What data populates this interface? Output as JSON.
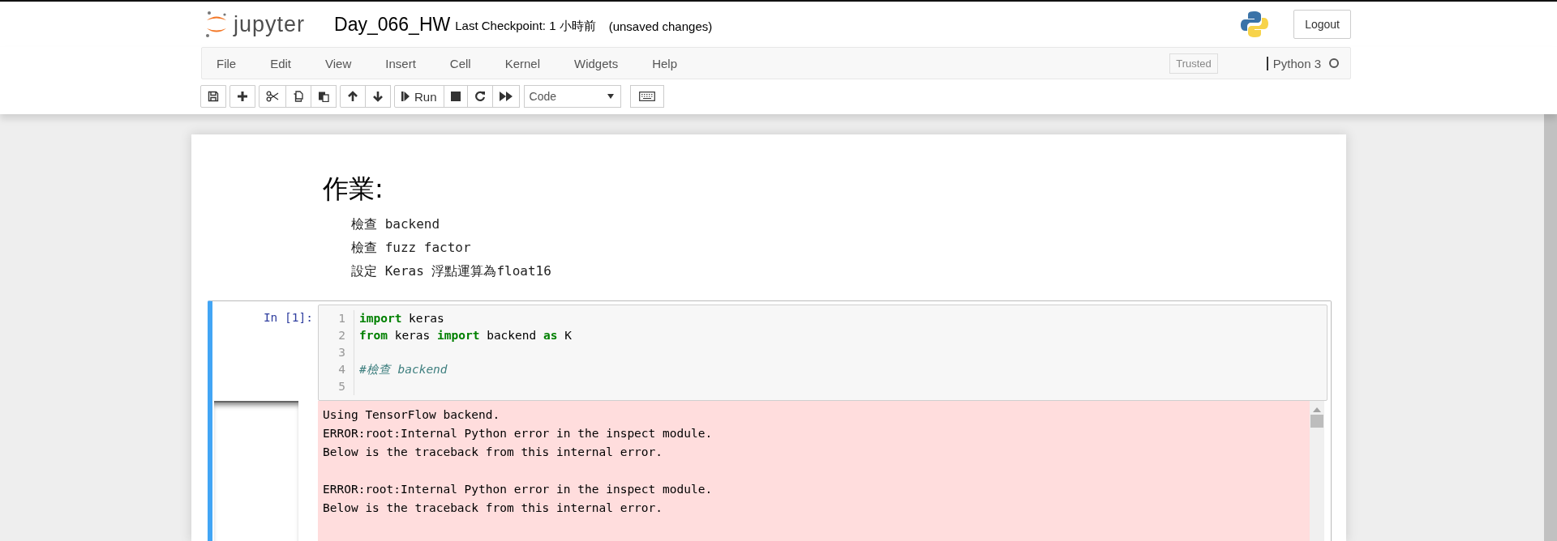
{
  "header": {
    "logo_text": "jupyter",
    "notebook_name": "Day_066_HW",
    "checkpoint": "Last Checkpoint: 1 小時前",
    "autosave": "(unsaved changes)",
    "logout": "Logout"
  },
  "menubar": {
    "items": [
      "File",
      "Edit",
      "View",
      "Insert",
      "Cell",
      "Kernel",
      "Widgets",
      "Help"
    ],
    "trusted": "Trusted",
    "kernel_name": "Python 3",
    "kernel_busy": false
  },
  "toolbar": {
    "groups": [
      [
        {
          "kind": "save"
        }
      ],
      [
        {
          "kind": "add"
        }
      ],
      [
        {
          "kind": "cut"
        },
        {
          "kind": "copy"
        },
        {
          "kind": "paste"
        }
      ],
      [
        {
          "kind": "up"
        },
        {
          "kind": "down"
        }
      ],
      [
        {
          "kind": "run",
          "label": "Run"
        },
        {
          "kind": "stop"
        },
        {
          "kind": "restart"
        },
        {
          "kind": "fast-forward"
        }
      ]
    ],
    "cell_type": "Code"
  },
  "cells": [
    {
      "kind": "markdown",
      "heading": "作業:",
      "items": [
        "檢查 backend",
        "檢查 fuzz factor",
        "設定 Keras 浮點運算為float16"
      ]
    },
    {
      "kind": "code",
      "selected": true,
      "prompt": "In [1]:",
      "lines": [
        {
          "number": "1",
          "tokens": [
            {
              "kind": "keyword",
              "text": "import"
            },
            {
              "kind": "name",
              "text": " keras"
            }
          ]
        },
        {
          "number": "2",
          "tokens": [
            {
              "kind": "keyword",
              "text": "from"
            },
            {
              "kind": "name",
              "text": " keras "
            },
            {
              "kind": "keyword",
              "text": "import"
            },
            {
              "kind": "name",
              "text": " backend "
            },
            {
              "kind": "keyword",
              "text": "as"
            },
            {
              "kind": "name",
              "text": " K"
            }
          ]
        },
        {
          "number": "3"
        },
        {
          "number": "4",
          "tokens": [
            {
              "kind": "comment",
              "text": "#檢查 backend"
            }
          ]
        },
        {
          "number": "5"
        }
      ],
      "output": {
        "kind": "stderr",
        "paragraphs": [
          [
            "Using TensorFlow backend.",
            "ERROR:root:Internal Python error in the inspect module.",
            "Below is the traceback from this internal error."
          ],
          [
            "ERROR:root:Internal Python error in the inspect module.",
            "Below is the traceback from this internal error."
          ]
        ]
      }
    }
  ]
}
